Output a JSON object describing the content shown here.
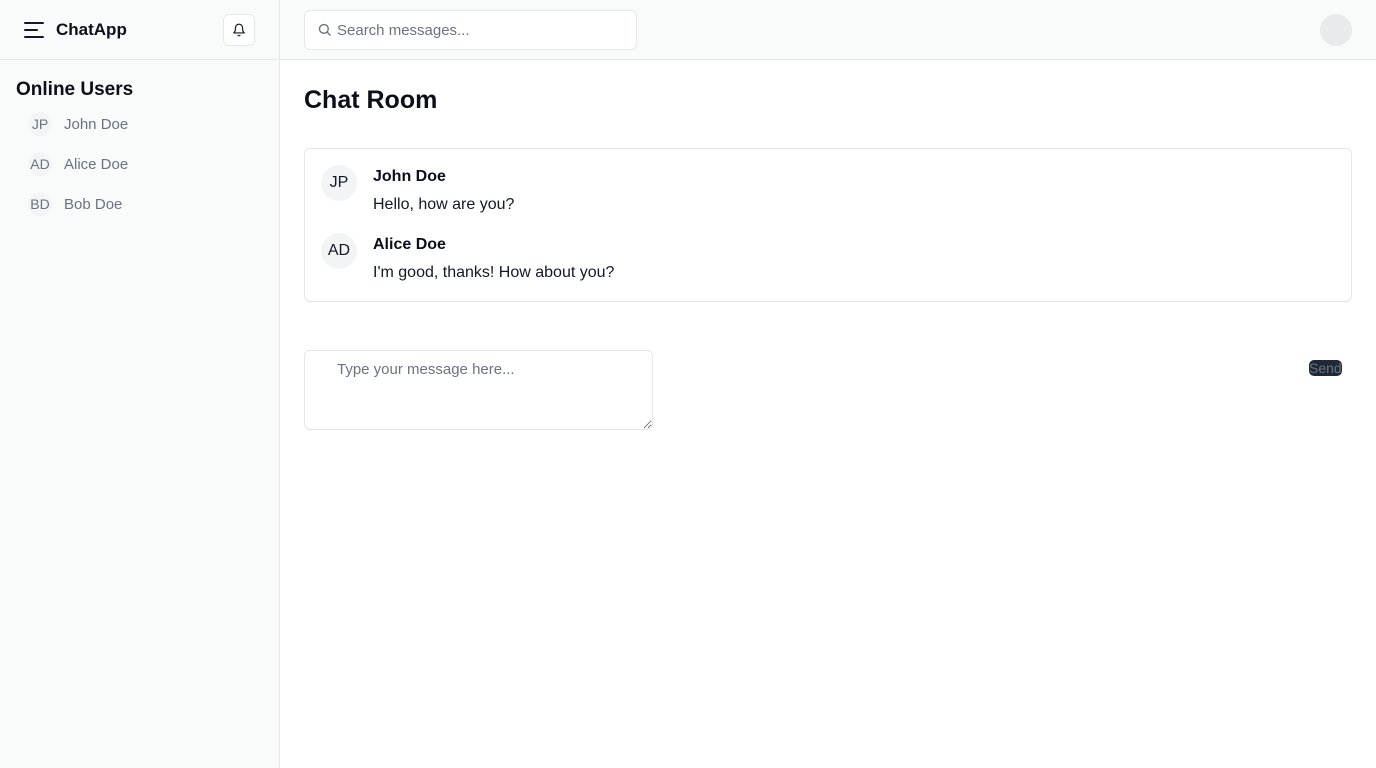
{
  "app": {
    "name": "ChatApp"
  },
  "sidebar": {
    "title": "Online Users",
    "users": [
      {
        "initials": "JP",
        "name": "John Doe"
      },
      {
        "initials": "AD",
        "name": "Alice Doe"
      },
      {
        "initials": "BD",
        "name": "Bob Doe"
      }
    ]
  },
  "topbar": {
    "search_placeholder": "Search messages..."
  },
  "main": {
    "title": "Chat Room",
    "messages": [
      {
        "initials": "JP",
        "author": "John Doe",
        "text": "Hello, how are you?"
      },
      {
        "initials": "AD",
        "author": "Alice Doe",
        "text": "I'm good, thanks! How about you?"
      }
    ],
    "composer_placeholder": "Type your message here...",
    "send_label": "Send"
  },
  "icons": {
    "menu": "menu-icon",
    "notifications": "bell-icon",
    "search": "search-icon",
    "profile": "avatar"
  },
  "colors": {
    "sidebar_bg": "#f9fafa",
    "border": "#e5e7eb",
    "send_button_bg": "#1f2937",
    "muted_text": "#6b7280"
  }
}
